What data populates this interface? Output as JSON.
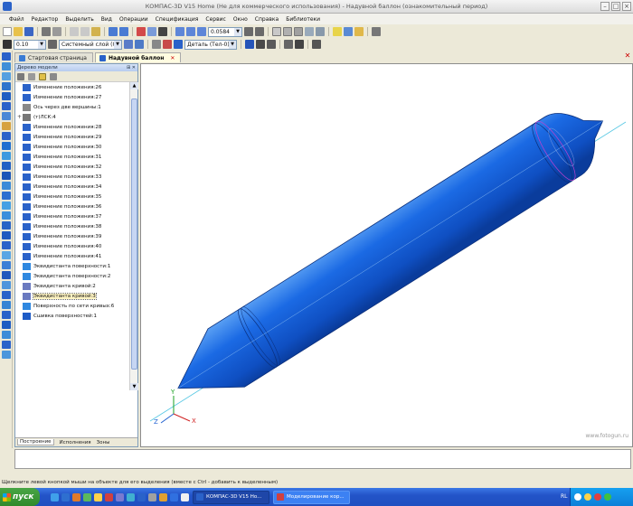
{
  "window": {
    "title": "КОМПАС-3D V15 Home (Не для коммерческого использования) - Надувной баллон (ознакомительный период)"
  },
  "menu": [
    "Файл",
    "Редактор",
    "Выделить",
    "Вид",
    "Операции",
    "Спецификация",
    "Сервис",
    "Окно",
    "Справка",
    "Библиотеки"
  ],
  "toolbar": {
    "scale_value": "0.0584",
    "line_width": "0.10",
    "layer": "Системный слой (0)",
    "detail_state": "Деталь (Тел-0)"
  },
  "tabs": [
    {
      "label": "Стартовая страница"
    },
    {
      "label": "Надувной баллон"
    }
  ],
  "tree": {
    "header": "Дерево модели",
    "items": [
      {
        "label": "Изменение положения:26",
        "icon": "reposition-icon"
      },
      {
        "label": "Изменение положения:27",
        "icon": "reposition-icon"
      },
      {
        "label": "Ось через две вершины:1",
        "icon": "axis-icon"
      },
      {
        "label": "(т)ЛСК:4",
        "icon": "lcs-icon",
        "expand": "+"
      },
      {
        "label": "Изменение положения:28",
        "icon": "reposition-icon"
      },
      {
        "label": "Изменение положения:29",
        "icon": "reposition-icon"
      },
      {
        "label": "Изменение положения:30",
        "icon": "reposition-icon"
      },
      {
        "label": "Изменение положения:31",
        "icon": "reposition-icon"
      },
      {
        "label": "Изменение положения:32",
        "icon": "reposition-icon"
      },
      {
        "label": "Изменение положения:33",
        "icon": "reposition-icon"
      },
      {
        "label": "Изменение положения:34",
        "icon": "reposition-icon"
      },
      {
        "label": "Изменение положения:35",
        "icon": "reposition-icon"
      },
      {
        "label": "Изменение положения:36",
        "icon": "reposition-icon"
      },
      {
        "label": "Изменение положения:37",
        "icon": "reposition-icon"
      },
      {
        "label": "Изменение положения:38",
        "icon": "reposition-icon"
      },
      {
        "label": "Изменение положения:39",
        "icon": "reposition-icon"
      },
      {
        "label": "Изменение положения:40",
        "icon": "reposition-icon"
      },
      {
        "label": "Изменение положения:41",
        "icon": "reposition-icon"
      },
      {
        "label": "Эквидистанта поверхности:1",
        "icon": "surface-icon"
      },
      {
        "label": "Эквидистанта поверхности:2",
        "icon": "surface-icon"
      },
      {
        "label": "Эквидистанта кривой:2",
        "icon": "curve-icon"
      },
      {
        "label": "Эквидистанта кривой:3",
        "icon": "curve-icon",
        "highlighted": true
      },
      {
        "label": "Поверхность по сети кривых:6",
        "icon": "surface-icon"
      },
      {
        "label": "Сшивка поверхностей:1",
        "icon": "stitch-icon"
      }
    ],
    "bottom_tabs": [
      "Построение",
      "Исполнения",
      "Зоны"
    ]
  },
  "viewport": {
    "watermark": "www.fotogun.ru",
    "axis_labels": {
      "x": "X",
      "y": "Y",
      "z": "Z"
    }
  },
  "status": {
    "hint": "Щелкните левой кнопкой мыши на объекте для его выделения (вместе с Ctrl - добавить к выделенным)"
  },
  "taskbar": {
    "start_label": "пуск",
    "tasks": [
      {
        "label": "КОМПАС-3D V15 Ho..."
      },
      {
        "label": "Моделирование кор..."
      }
    ],
    "lang": "RL"
  },
  "colors": {
    "balloon": "#1a66e0",
    "balloon_dark": "#0a3c9c",
    "accent": "#2354c8"
  }
}
